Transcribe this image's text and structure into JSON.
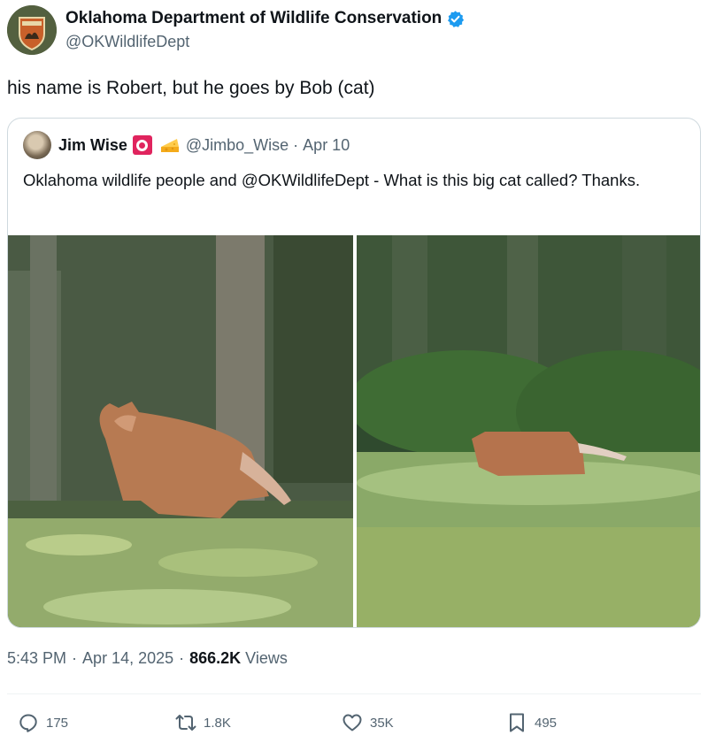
{
  "author": {
    "display_name": "Oklahoma Department of Wildlife Conservation",
    "handle": "@OKWildlifeDept",
    "verified": true,
    "verified_color": "#1d9bf0"
  },
  "tweet": {
    "text": "his name is Robert, but he goes by Bob (cat)"
  },
  "quoted_tweet": {
    "display_name": "Jim Wise",
    "handle": "@Jimbo_Wise",
    "separator": "·",
    "date": "Apr 10",
    "text": "Oklahoma wildlife people and @OKWildlifeDept - What is this big cat called? Thanks.",
    "badge_color": "#e0245e",
    "photos": [
      {
        "icon": "bobcat-photo-left"
      },
      {
        "icon": "bobcat-photo-right"
      }
    ]
  },
  "meta": {
    "time": "5:43 PM",
    "separator": "·",
    "date": "Apr 14, 2025",
    "views_count": "866.2K",
    "views_label": "Views"
  },
  "actions": {
    "reply_count": "175",
    "retweet_count": "1.8K",
    "like_count": "35K",
    "bookmark_count": "495"
  }
}
